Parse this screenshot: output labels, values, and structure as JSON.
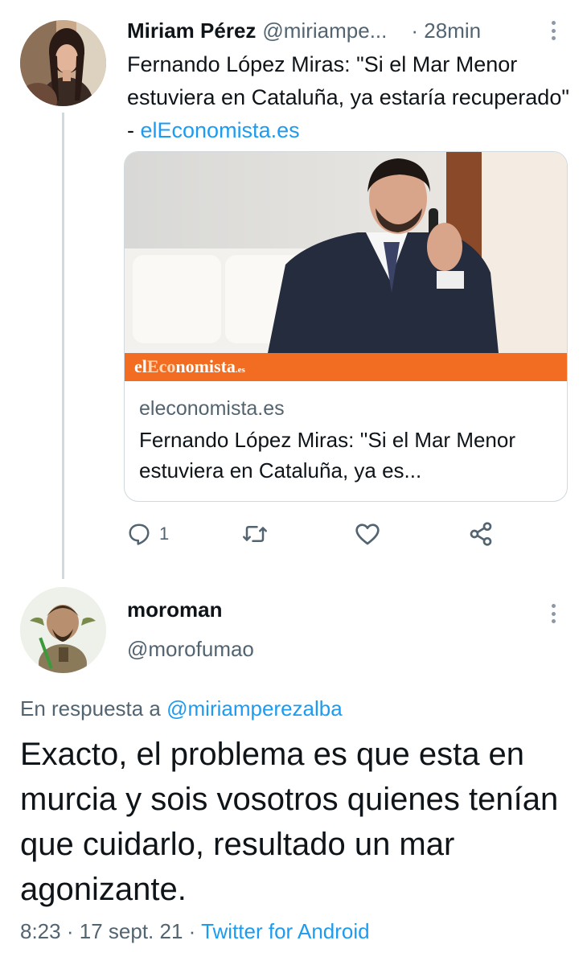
{
  "tweet1": {
    "name": "Miriam Pérez",
    "handle": "@miriampe...",
    "separator": "·",
    "time": "28min",
    "text_plain": "Fernando López Miras: \"Si el Mar Menor estuviera en Cataluña, ya estaría recuperado\" - ",
    "text_link": "elEconomista.es",
    "card": {
      "brand_logo_text": "elEconomista.es",
      "domain": "eleconomista.es",
      "title": "Fernando López Miras: ''Si el Mar Menor estuviera en Cataluña, ya es..."
    },
    "actions": {
      "reply_icon": "reply-icon",
      "reply_count": "1",
      "retweet_icon": "retweet-icon",
      "like_icon": "heart-icon",
      "share_icon": "share-icon"
    }
  },
  "tweet2": {
    "name": "moroman",
    "handle": "@morofumao",
    "reply_prefix": "En respuesta a ",
    "reply_handle": "@miriamperezalba",
    "text": "Exacto, el problema es que esta en murcia y sois vosotros quienes tenían que cuidarlo, resultado un mar agonizante.",
    "time": "8:23",
    "date": "17 sept. 21",
    "separator": "·",
    "source": "Twitter for Android"
  },
  "colors": {
    "link": "#1d9bf0",
    "secondary_text": "#536471",
    "brand_orange": "#f26d21",
    "thread_line": "#cfd9de"
  }
}
